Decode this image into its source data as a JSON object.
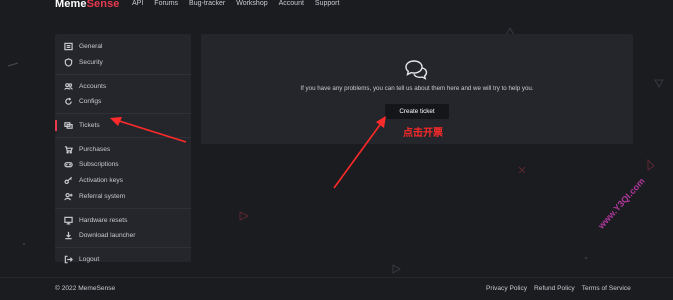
{
  "brand": {
    "part1": "Meme",
    "part2": "Sense",
    "accent_color": "#e8394e"
  },
  "nav": [
    "API",
    "Forums",
    "Bug-tracker",
    "Workshop",
    "Account",
    "Support"
  ],
  "sidebar": {
    "items": [
      {
        "label": "General",
        "icon": "general-icon"
      },
      {
        "label": "Security",
        "icon": "shield-icon"
      },
      {
        "label": "Accounts",
        "icon": "users-icon"
      },
      {
        "label": "Configs",
        "icon": "refresh-icon"
      },
      {
        "label": "Tickets",
        "icon": "tickets-icon",
        "active": true
      },
      {
        "label": "Purchases",
        "icon": "cart-icon"
      },
      {
        "label": "Subscriptions",
        "icon": "gamepad-icon"
      },
      {
        "label": "Activation keys",
        "icon": "key-icon"
      },
      {
        "label": "Referral system",
        "icon": "add-user-icon"
      },
      {
        "label": "Hardware resets",
        "icon": "monitor-icon"
      },
      {
        "label": "Download launcher",
        "icon": "download-icon"
      },
      {
        "label": "Logout",
        "icon": "logout-icon"
      }
    ]
  },
  "main": {
    "help_text": "If you have any problems, you can tell us about them here and we will try to help you.",
    "create_button": "Create ticket",
    "icon": "chat-bubbles-icon"
  },
  "annotation": {
    "label": "点击开票",
    "color": "#ff2a2a"
  },
  "footer": {
    "copyright": "© 2022 MemeSense",
    "links": [
      "Privacy Policy",
      "Refund Policy",
      "Terms of Service"
    ]
  },
  "watermark": "www.Y3QI.com"
}
